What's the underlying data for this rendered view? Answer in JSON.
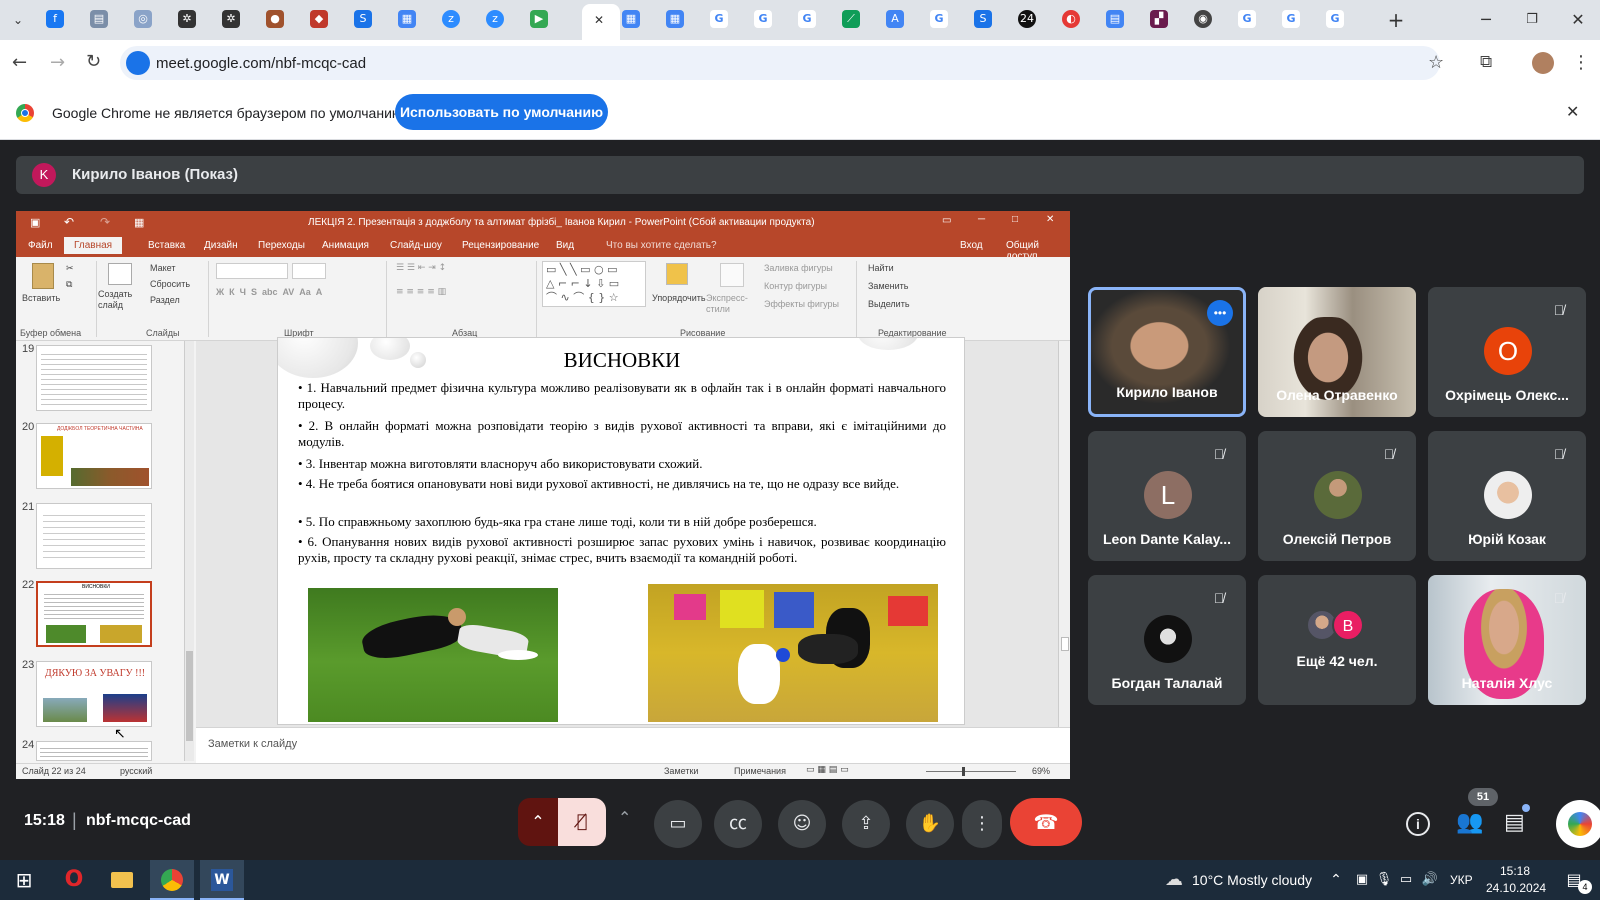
{
  "browser": {
    "url": "meet.google.com/nbf-mcqc-cad",
    "tab_close": "✕",
    "new_tab": "+"
  },
  "infobar": {
    "message": "Google Chrome не является браузером по умолчанию.",
    "button": "Использовать по умолчанию"
  },
  "presenter": {
    "avatar": "K",
    "label": "Кирило Іванов (Показ)"
  },
  "powerpoint": {
    "title": "ЛЕКЦІЯ 2. Презентація з доджболу та алтимат фрізбі_ Іванов Кирил - PowerPoint (Сбой активации продукта)",
    "tabs": [
      "Файл",
      "Главная",
      "Вставка",
      "Дизайн",
      "Переходы",
      "Анимация",
      "Слайд-шоу",
      "Рецензирование",
      "Вид"
    ],
    "search": "Что вы хотите сделать?",
    "signin": "Вход",
    "share": "Общий доступ",
    "ribbon": {
      "paste": "Вставить",
      "create_slide": "Создать слайд",
      "layout": "Макет",
      "reset": "Сбросить",
      "section": "Раздел",
      "arrange": "Упорядочить",
      "express_styles": "Экспресс-стили",
      "fill": "Заливка фигуры",
      "outline": "Контур фигуры",
      "effects": "Эффекты фигуры",
      "find": "Найти",
      "replace": "Заменить",
      "select": "Выделить",
      "groups": [
        "Буфер обмена",
        "Слайды",
        "Шрифт",
        "Абзац",
        "Рисование",
        "Редактирование"
      ]
    },
    "thumbnails": [
      {
        "num": "19",
        "text": ""
      },
      {
        "num": "20",
        "text": "ДОДЖБОЛ ТЕОРЕТИЧНА ЧАСТИНА"
      },
      {
        "num": "21",
        "text": ""
      },
      {
        "num": "22",
        "text": "ВИСНОВКИ"
      },
      {
        "num": "23",
        "text": "ДЯКУЮ ЗА УВАГУ !!!"
      },
      {
        "num": "24",
        "text": ""
      }
    ],
    "slide": {
      "title": "ВИСНОВКИ",
      "points": [
        "• 1. Навчальний предмет фізична культура можливо реалізовувати як в офлайн так і в онлайн форматі навчального процесу.",
        "• 2. В онлайн форматі можна розповідати теорію з видів рухової активності та вправи, які є імітаційними до модулів.",
        "• 3. Інвентар можна виготовляти власноруч або використовувати схожий.",
        "• 4. Не треба боятися опановувати нові види рухової активності, не дивлячись на те, що не одразу все вийде.",
        "• 5. По справжньому захоплюю будь-яка гра стане лише тоді, коли ти в ній добре розберешся.",
        "• 6. Опанування нових видів рухової активності розширює запас рухових умінь і навичок, розвиває координацію рухів, просту та складну рухові реакції, знімає стрес, вчить взаємодії та командній роботі."
      ]
    },
    "notes": "Заметки к слайду",
    "status_slide": "Слайд 22 из 24",
    "status_lang": "русский",
    "status_notes": "Заметки",
    "status_comments": "Примечания",
    "zoom": "69%"
  },
  "participants": [
    {
      "name": "Кирило Іванов",
      "type": "video",
      "muted": false
    },
    {
      "name": "Олена Отравенко",
      "type": "video",
      "muted": false
    },
    {
      "name": "Охрімець Олекс...",
      "type": "avatar",
      "initial": "О",
      "color": "#e8430a",
      "muted": true
    },
    {
      "name": "Leon Dante Kalay...",
      "type": "avatar",
      "initial": "L",
      "color": "#8d6e63",
      "muted": true
    },
    {
      "name": "Олексій Петров",
      "type": "photo",
      "muted": true
    },
    {
      "name": "Юрій Козак",
      "type": "photo",
      "muted": true
    },
    {
      "name": "Богдан Талалай",
      "type": "photo",
      "muted": true
    },
    {
      "name": "Ещё 42 чел.",
      "type": "more",
      "initial": "B",
      "muted": false
    },
    {
      "name": "Наталія Хлус",
      "type": "video",
      "muted": true
    }
  ],
  "meeting": {
    "time": "15:18",
    "code": "nbf-mcqc-cad",
    "people_count": "51"
  },
  "taskbar": {
    "weather": "10°C  Mostly cloudy",
    "lang": "УКР",
    "time": "15:18",
    "date": "24.10.2024",
    "notifications": "4"
  },
  "colors": {
    "meet_bg": "#202124",
    "ppt_accent": "#b7472a",
    "end_call": "#ea4335",
    "chrome_blue": "#1a73e8"
  }
}
